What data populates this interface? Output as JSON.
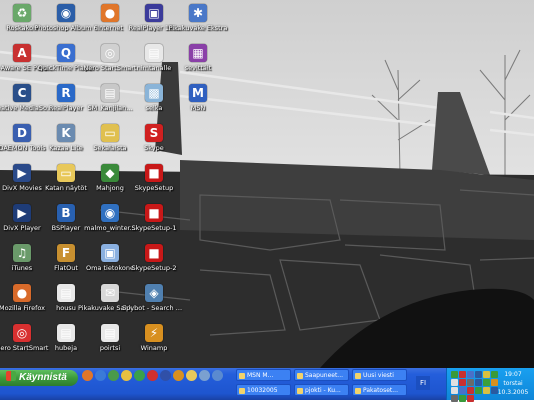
{
  "desktop": {
    "icons": [
      {
        "label": "Roskakori",
        "icon": "recycle-bin-icon",
        "color": "#6aa86a",
        "glyph": "♻"
      },
      {
        "label": "Photoshop Album 6",
        "icon": "photoshop-album-icon",
        "color": "#2b5ea8",
        "glyph": "◉"
      },
      {
        "label": "Internet",
        "icon": "firefox-icon",
        "color": "#e0762a",
        "glyph": "●"
      },
      {
        "label": "RealPlayer 10...",
        "icon": "realplayer-icon",
        "color": "#3b3b9b",
        "glyph": "▣"
      },
      {
        "label": "Pikakuvake Ekstra",
        "icon": "shortcut-icon",
        "color": "#4a78c8",
        "glyph": "✱"
      },
      {
        "label": "Ad-Aware SE Personal",
        "icon": "ad-aware-icon",
        "color": "#c83030",
        "glyph": "A"
      },
      {
        "label": "QuickTime Player",
        "icon": "quicktime-icon",
        "color": "#3a6fd0",
        "glyph": "Q"
      },
      {
        "label": "Nero StartSmart",
        "icon": "nero-icon",
        "color": "#d0d0d0",
        "glyph": "◎"
      },
      {
        "label": "nimtanalle",
        "icon": "document-icon",
        "color": "#e8e8e8",
        "glyph": "▤"
      },
      {
        "label": "sevittäit",
        "icon": "winrar-archive-icon",
        "color": "#8a3fa8",
        "glyph": "▦"
      },
      {
        "label": "Creative MediaSource",
        "icon": "creative-icon",
        "color": "#2a4f8a",
        "glyph": "C"
      },
      {
        "label": "RealPlayer",
        "icon": "realplayer-icon",
        "color": "#2a69c8",
        "glyph": "R"
      },
      {
        "label": "SM_Kanjilan...",
        "icon": "pdf-icon",
        "color": "#c8c8c8",
        "glyph": "▤"
      },
      {
        "label": "selka",
        "icon": "image-file-icon",
        "color": "#8ab4d8",
        "glyph": "▩"
      },
      {
        "label": "MSN",
        "icon": "msn-icon",
        "color": "#3060c0",
        "glyph": "M"
      },
      {
        "label": "DAEMON Tools",
        "icon": "daemon-tools-icon",
        "color": "#3a5fb0",
        "glyph": "D"
      },
      {
        "label": "Kazaa Lite",
        "icon": "kazaa-icon",
        "color": "#6b8bb0",
        "glyph": "K"
      },
      {
        "label": "Sekalaista",
        "icon": "folder-icon",
        "color": "#e0c050",
        "glyph": "▭"
      },
      {
        "label": "Skype",
        "icon": "skype-setup-icon",
        "color": "#d02020",
        "glyph": "S"
      },
      {
        "label": "DivX Movies",
        "icon": "divx-movies-icon",
        "color": "#2a4a8a",
        "glyph": "▶"
      },
      {
        "label": "Katan näytöt",
        "icon": "folder-icon",
        "color": "#e8c85a",
        "glyph": "▭"
      },
      {
        "label": "Mahjong",
        "icon": "mahjong-icon",
        "color": "#3a8a3a",
        "glyph": "◆"
      },
      {
        "label": "SkypeSetup",
        "icon": "skype-setup-icon",
        "color": "#c81818",
        "glyph": "■"
      },
      {
        "label": "DivX Player",
        "icon": "divx-player-icon",
        "color": "#1e3c78",
        "glyph": "▶"
      },
      {
        "label": "BSPlayer",
        "icon": "bsplayer-icon",
        "color": "#2860b0",
        "glyph": "B"
      },
      {
        "label": "malmo_winter...",
        "icon": "video-file-icon",
        "color": "#3070c0",
        "glyph": "◉"
      },
      {
        "label": "SkypeSetup-1",
        "icon": "skype-setup-icon",
        "color": "#c81818",
        "glyph": "■"
      },
      {
        "label": "iTunes",
        "icon": "itunes-icon",
        "color": "#6a9a6a",
        "glyph": "♫"
      },
      {
        "label": "FlatOut",
        "icon": "flatout-icon",
        "color": "#c89030",
        "glyph": "F"
      },
      {
        "label": "Oma tietokone",
        "icon": "my-computer-icon",
        "color": "#8ab0e0",
        "glyph": "▣"
      },
      {
        "label": "SkypeSetup-2",
        "icon": "skype-setup-icon",
        "color": "#c81818",
        "glyph": "■"
      },
      {
        "label": "Mozilla Firefox",
        "icon": "firefox-icon",
        "color": "#d86a2a",
        "glyph": "●"
      },
      {
        "label": "housu",
        "icon": "document-icon",
        "color": "#e8e8e8",
        "glyph": "▤"
      },
      {
        "label": "Pikakuvake Sahköposti",
        "icon": "email-shortcut-icon",
        "color": "#d8d8d8",
        "glyph": "✉"
      },
      {
        "label": "Spybot - Search & Destroy",
        "icon": "spybot-icon",
        "color": "#5080b0",
        "glyph": "◈"
      },
      {
        "label": "Nero StartSmart",
        "icon": "nero-icon",
        "color": "#d83030",
        "glyph": "◎"
      },
      {
        "label": "hubeja",
        "icon": "document-icon",
        "color": "#e8e8e8",
        "glyph": "▤"
      },
      {
        "label": "poirtsi",
        "icon": "document-icon",
        "color": "#e8e8e8",
        "glyph": "▤"
      },
      {
        "label": "Winamp",
        "icon": "winamp-icon",
        "color": "#d89020",
        "glyph": "⚡"
      }
    ]
  },
  "taskbar": {
    "start_label": "Käynnistä",
    "quicklaunch": [
      {
        "icon": "firefox-icon",
        "color": "#e0762a"
      },
      {
        "icon": "internet-explorer-icon",
        "color": "#3a7ad8"
      },
      {
        "icon": "media-player-icon",
        "color": "#4a9a4a"
      },
      {
        "icon": "outlook-icon",
        "color": "#e8c040"
      },
      {
        "icon": "msn-icon",
        "color": "#3aa04a"
      },
      {
        "icon": "nero-icon",
        "color": "#d03030"
      },
      {
        "icon": "realplayer-icon",
        "color": "#3050a8"
      },
      {
        "icon": "winamp-icon",
        "color": "#d89020"
      },
      {
        "icon": "folder-icon",
        "color": "#e8c85a"
      },
      {
        "icon": "mail-icon",
        "color": "#7aa0d0"
      },
      {
        "icon": "desktop-icon",
        "color": "#5a8ad0"
      }
    ],
    "tasks": [
      {
        "label": "MSN M..."
      },
      {
        "label": "Saapuneet..."
      },
      {
        "label": "Uusi viesti"
      },
      {
        "label": "10032005"
      },
      {
        "label": "pjokti - Ku..."
      },
      {
        "label": "Pakatoset..."
      }
    ],
    "language": "FI",
    "clock": {
      "time": "19:07",
      "day": "torstai",
      "date": "10.3.2005"
    },
    "tray_colors": [
      "#3a9a3a",
      "#c83030",
      "#4a70c8",
      "#2a5aa0",
      "#d8c040",
      "#3a9a3a",
      "#e0e0e0",
      "#c83030",
      "#6a6a6a",
      "#2a5aa0",
      "#3aa03a",
      "#d89020",
      "#e0e0e0",
      "#4a70c8",
      "#c83030",
      "#3a9a3a",
      "#d8c040",
      "#2a5aa0",
      "#6a6a6a",
      "#3a9a3a",
      "#c83030"
    ]
  }
}
